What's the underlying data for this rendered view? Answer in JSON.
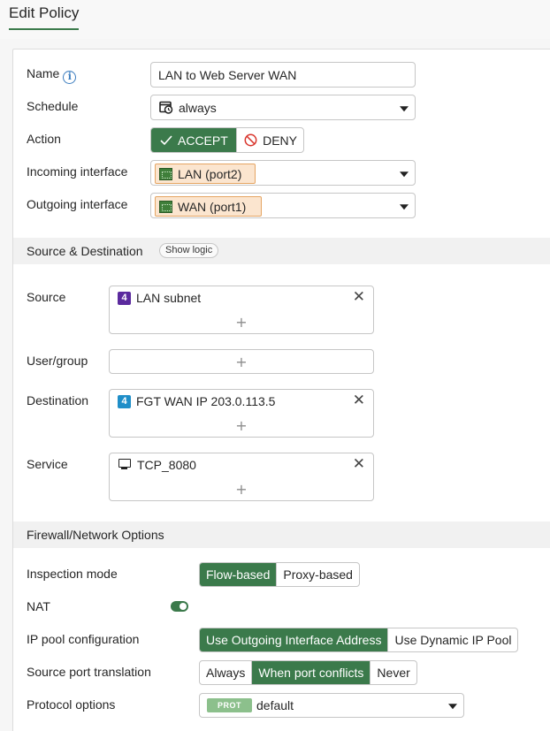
{
  "page": {
    "title": "Edit Policy"
  },
  "form": {
    "name": {
      "label": "Name",
      "value": "LAN to Web Server WAN"
    },
    "schedule": {
      "label": "Schedule",
      "value": "always"
    },
    "action": {
      "label": "Action",
      "options": [
        "ACCEPT",
        "DENY"
      ],
      "selected": "ACCEPT"
    },
    "incoming": {
      "label": "Incoming interface",
      "value": "LAN (port2)"
    },
    "outgoing": {
      "label": "Outgoing interface",
      "value": "WAN (port1)"
    }
  },
  "source_destination": {
    "heading": "Source & Destination",
    "show_logic": "Show logic",
    "source": {
      "label": "Source",
      "entries": [
        "LAN subnet"
      ]
    },
    "user_group": {
      "label": "User/group",
      "entries": []
    },
    "destination": {
      "label": "Destination",
      "entries": [
        "FGT WAN IP 203.0.113.5"
      ]
    },
    "service": {
      "label": "Service",
      "entries": [
        "TCP_8080"
      ]
    },
    "add_glyph": "+",
    "remove_glyph": "✕"
  },
  "firewall_options": {
    "heading": "Firewall/Network Options",
    "inspection_mode": {
      "label": "Inspection mode",
      "options": [
        "Flow-based",
        "Proxy-based"
      ],
      "selected": "Flow-based"
    },
    "nat": {
      "label": "NAT",
      "enabled": true
    },
    "ip_pool": {
      "label": "IP pool configuration",
      "options": [
        "Use Outgoing Interface Address",
        "Use Dynamic IP Pool"
      ],
      "selected": "Use Outgoing Interface Address"
    },
    "source_port": {
      "label": "Source port translation",
      "options": [
        "Always",
        "When port conflicts",
        "Never"
      ],
      "selected": "When port conflicts"
    },
    "protocol_options": {
      "label": "Protocol options",
      "badge": "PROT",
      "value": "default"
    }
  },
  "icons": {
    "info": "info-icon",
    "schedule": "clock-calendar-icon",
    "accept": "checkmark-icon",
    "deny": "no-entry-icon",
    "interface": "network-port-icon",
    "address_v4": "ipv4-address-icon",
    "service": "monitor-service-icon",
    "dropdown": "chevron-down-icon"
  },
  "colors": {
    "accent_green": "#3b7a4b",
    "interface_chip_bg": "#fbe5cf",
    "interface_chip_border": "#e5a563",
    "address_purple": "#5b2a9e",
    "address_blue": "#1f8ec8",
    "info_blue": "#3b7dbf",
    "deny_red": "#d9342b"
  }
}
